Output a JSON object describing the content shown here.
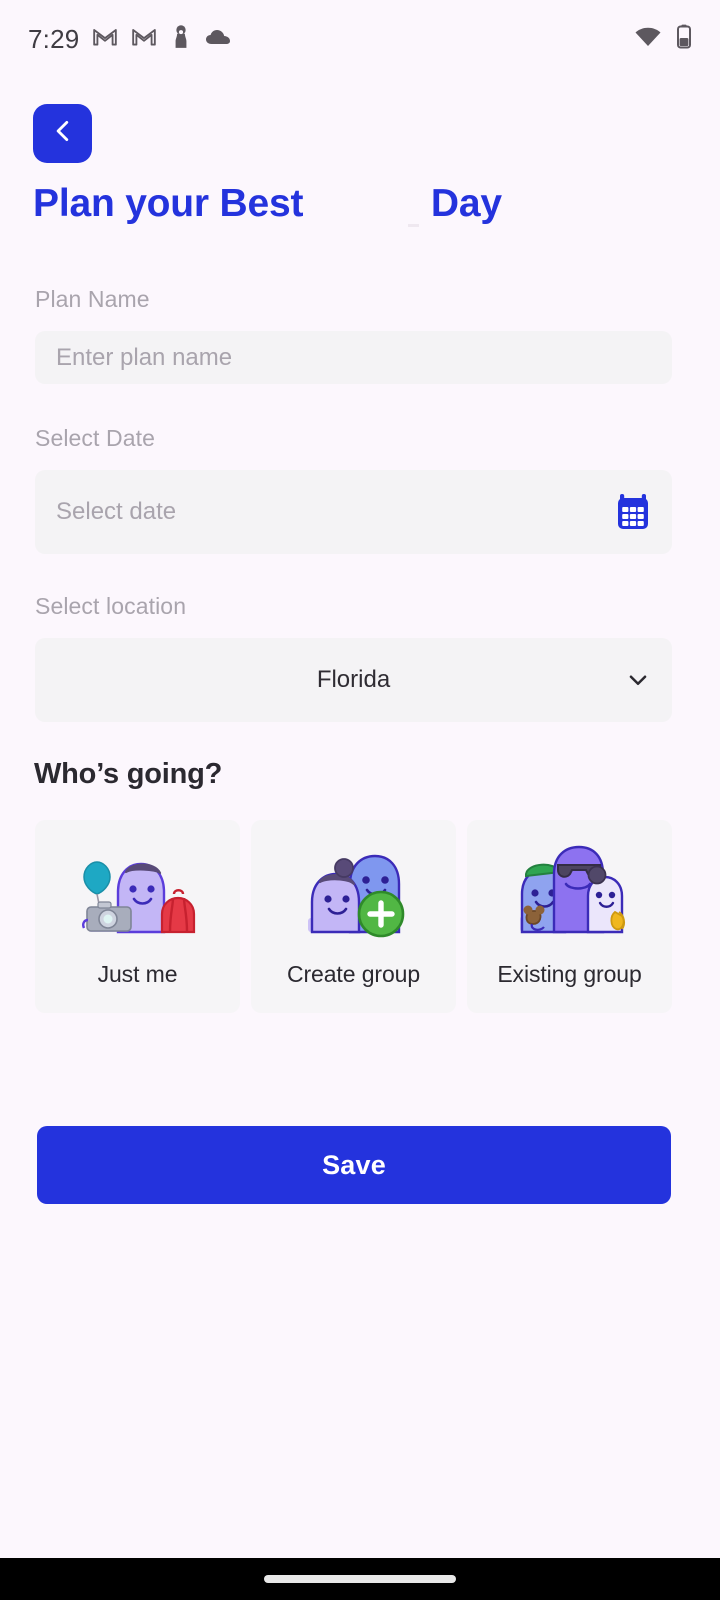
{
  "statusbar": {
    "time": "7:29",
    "left_icons": [
      "gmail-icon",
      "gmail-icon",
      "chess-pawn-icon",
      "cloud-icon"
    ],
    "right_icons": [
      "wifi-icon",
      "battery-icon"
    ],
    "icon_color": "#5d585f"
  },
  "header": {
    "back_label": "chevron-left-icon",
    "title": "Plan your Best            Day",
    "accent_color": "#2433dd"
  },
  "form": {
    "plan_name": {
      "label": "Plan Name",
      "placeholder": "Enter plan name",
      "value": ""
    },
    "date": {
      "label": "Select Date",
      "placeholder": "Select date",
      "value": "",
      "icon": "calendar-icon"
    },
    "location": {
      "label": "Select location",
      "value": "Florida",
      "icon": "chevron-down-icon"
    }
  },
  "who_section": {
    "title": "Who’s going?",
    "options": [
      {
        "label": "Just me",
        "art": "person-with-balloon-camera-backpack"
      },
      {
        "label": "Create group",
        "art": "two-people-with-plus-badge"
      },
      {
        "label": "Existing group",
        "art": "three-people-group"
      }
    ]
  },
  "actions": {
    "save_label": "Save"
  },
  "navbar": {
    "gesture_pill": "home-gesture-pill"
  },
  "colors": {
    "page_background": "#fcf7fd",
    "field_background": "#f4f3f5",
    "card_background": "#f6f5f7",
    "primary": "#2433dd",
    "muted_text": "#a9a4ad",
    "dark_text": "#2b2930"
  }
}
